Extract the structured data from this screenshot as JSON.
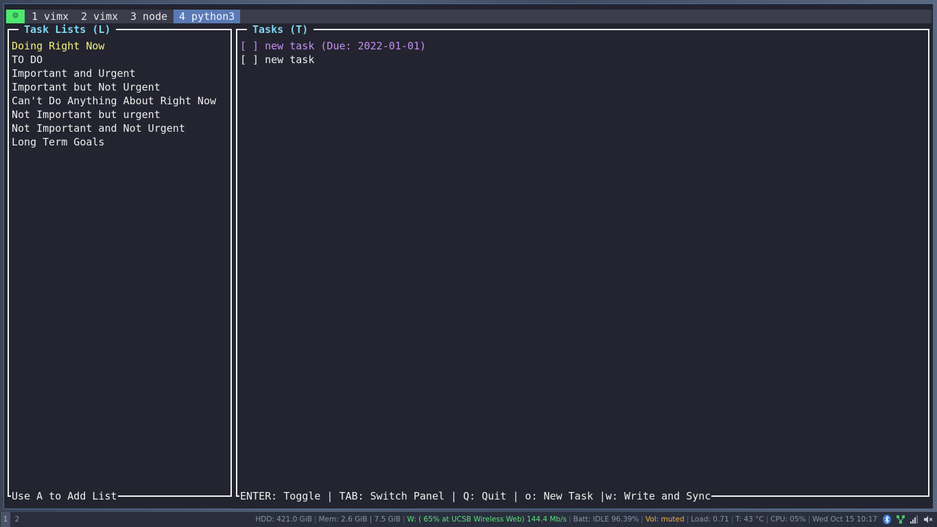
{
  "tabbar": {
    "indicator": "☺",
    "tabs": [
      {
        "label": "1 vimx",
        "active": false
      },
      {
        "label": "2 vimx",
        "active": false
      },
      {
        "label": "3 node",
        "active": false
      },
      {
        "label": "4 python3",
        "active": true
      }
    ]
  },
  "lists_panel": {
    "title": "Task Lists (L)",
    "footer": "Use A to Add List",
    "items": [
      "Doing Right Now",
      "TO DO",
      "Important and Urgent",
      "Important but Not Urgent",
      "Can't Do Anything About Right Now",
      "Not Important but urgent",
      "Not Important and Not Urgent",
      "Long Term Goals"
    ]
  },
  "tasks_panel": {
    "title": "Tasks (T)",
    "footer": "ENTER: Toggle | TAB: Switch Panel | Q: Quit | o: New Task |w: Write and Sync",
    "items": [
      "[ ] new task (Due: 2022-01-01)",
      "[ ] new task"
    ]
  },
  "statusbar": {
    "workspaces": [
      "1",
      "2"
    ],
    "hdd": "HDD: 421.0 GiB",
    "mem": "Mem: 2.6 GiB | 7.5 GiB",
    "wifi": "W: ( 65% at UCSB Wireless Web) 144.4 Mb/s",
    "batt": "Batt: IDLE 96.39%",
    "vol": "Vol: muted",
    "load": "Load: 0.71",
    "temp": "T: 43 °C",
    "cpu": "CPU: 05%",
    "datetime": "Wed Oct 15 10:17"
  },
  "colors": {
    "accent_green": "#4ee86e",
    "active_tab": "#5b7ab5",
    "panel_title": "#7fd6f0",
    "selected_list": "#f4f07a",
    "selected_task": "#c58ff0",
    "wifi_ok": "#5ee07a",
    "vol_muted": "#f0b04a"
  }
}
